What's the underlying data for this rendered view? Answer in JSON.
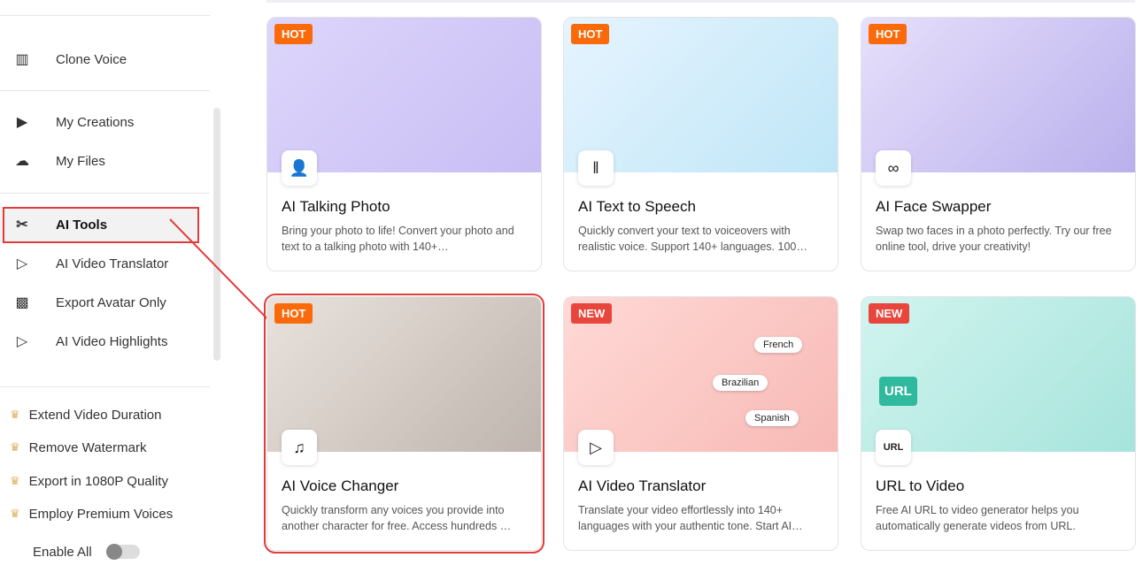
{
  "sidebar": {
    "items": [
      {
        "label": "Clone Voice",
        "icon": "waveform-icon"
      },
      {
        "label": "My Creations",
        "icon": "play-stack-icon"
      },
      {
        "label": "My Files",
        "icon": "cloud-upload-icon"
      },
      {
        "label": "AI Tools",
        "icon": "tools-icon"
      },
      {
        "label": "AI Video Translator",
        "icon": "video-translate-icon"
      },
      {
        "label": "Export Avatar Only",
        "icon": "avatar-icon"
      },
      {
        "label": "AI Video Highlights",
        "icon": "video-sparkle-icon"
      }
    ],
    "premium": [
      "Extend Video Duration",
      "Remove Watermark",
      "Export in 1080P Quality",
      "Employ Premium Voices"
    ],
    "enable_all": "Enable All",
    "enable_all_on": false
  },
  "cards": [
    {
      "badge": "HOT",
      "title": "AI Talking Photo",
      "desc": "Bring your photo to life! Convert your photo and text to a talking photo with 140+…"
    },
    {
      "badge": "HOT",
      "title": "AI Text to Speech",
      "desc": "Quickly convert your text to voiceovers with realistic voice. Support 140+ languages. 100…"
    },
    {
      "badge": "HOT",
      "title": "AI Face Swapper",
      "desc": "Swap two faces in a photo perfectly. Try our free online tool, drive your creativity!"
    },
    {
      "badge": "HOT",
      "title": "AI Voice Changer",
      "desc": "Quickly transform any voices you provide into another character for free. Access hundreds …"
    },
    {
      "badge": "NEW",
      "title": "AI Video Translator",
      "desc": "Translate your video effortlessly into 140+ languages with your authentic tone. Start AI…",
      "langs": [
        "French",
        "Brazilian",
        "Spanish"
      ]
    },
    {
      "badge": "NEW",
      "title": "URL to Video",
      "desc": "Free AI URL to video generator helps you automatically generate videos from URL.",
      "url_label": "URL"
    }
  ],
  "colors": {
    "hot": "#fa6a0a",
    "new": "#e8453c",
    "highlight": "#e03c3c"
  }
}
